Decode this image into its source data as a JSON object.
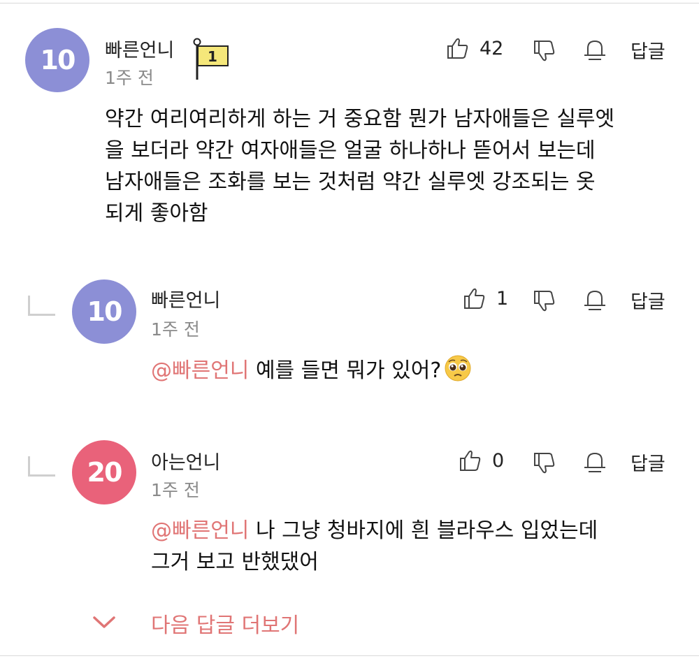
{
  "colors": {
    "avatar_10": "#8c8fd6",
    "avatar_20": "#e9627a",
    "mention": "#e07575",
    "flag": "#f5e77a"
  },
  "comments": [
    {
      "level": "10",
      "username": "빠른언니",
      "time": "1주 전",
      "flag_number": "1",
      "likes": "42",
      "reply_label": "답글",
      "lines": [
        "약간 여리여리하게 하는 거 중요함 뭔가 남자애들은 실루엣",
        "을 보더라 약간 여자애들은 얼굴 하나하나 뜯어서 보는데",
        "남자애들은 조화를 보는 것처럼 약간 실루엣 강조되는 옷",
        "되게 좋아함"
      ]
    },
    {
      "level": "10",
      "username": "빠른언니",
      "time": "1주 전",
      "likes": "1",
      "reply_label": "답글",
      "mention": "@빠른언니",
      "text": " 예를 들면 뭐가 있어?"
    },
    {
      "level": "20",
      "username": "아는언니",
      "time": "1주 전",
      "likes": "0",
      "reply_label": "답글",
      "mention": "@빠른언니",
      "line1": " 나 그냥 청바지에 흰 블라우스 입었는데",
      "line2": "그거 보고 반했댔어"
    }
  ],
  "more_replies": {
    "label": "다음 답글 더보기",
    "icon": "chevron-down-icon"
  },
  "icons": {
    "like": "thumbs-up-icon",
    "dislike": "thumbs-down-icon",
    "report": "bell-icon",
    "emoji": "pleading-face-emoji"
  }
}
